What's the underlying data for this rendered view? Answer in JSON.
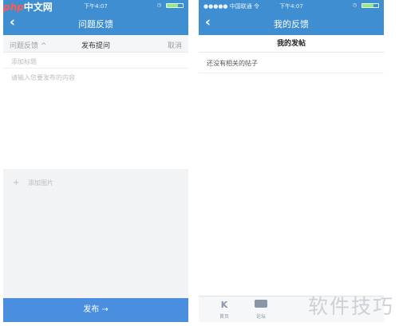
{
  "site_logo": {
    "prefix": "php",
    "suffix": "中文网"
  },
  "left_screen": {
    "status": {
      "carrier": "",
      "time": "下午4:07"
    },
    "nav": {
      "title": "问题反馈",
      "back_glyph": "‹"
    },
    "subheader": {
      "left": "问题反馈 ^",
      "center": "发布提问",
      "right": "取消"
    },
    "title_placeholder": "添加标题",
    "content_placeholder": "请输入您要发布的内容",
    "add_image_label": "添加图片",
    "add_image_glyph": "+",
    "publish_label": "发布 →"
  },
  "right_screen": {
    "status": {
      "carrier": "●●●●● 中国联通 令",
      "time": "下午4:07"
    },
    "nav": {
      "title": "我的反馈",
      "back_glyph": "‹"
    },
    "section_title": "我的发帖",
    "empty_notice": "还没有相关的帖子",
    "tabs": [
      {
        "label": "首页",
        "icon": "K"
      },
      {
        "label": "论坛",
        "icon": "forum-icon"
      }
    ]
  },
  "watermark": "软件技巧",
  "colors": {
    "primary": "#3f8ed1",
    "button": "#4a8ee0",
    "battery": "#8ef07a"
  }
}
